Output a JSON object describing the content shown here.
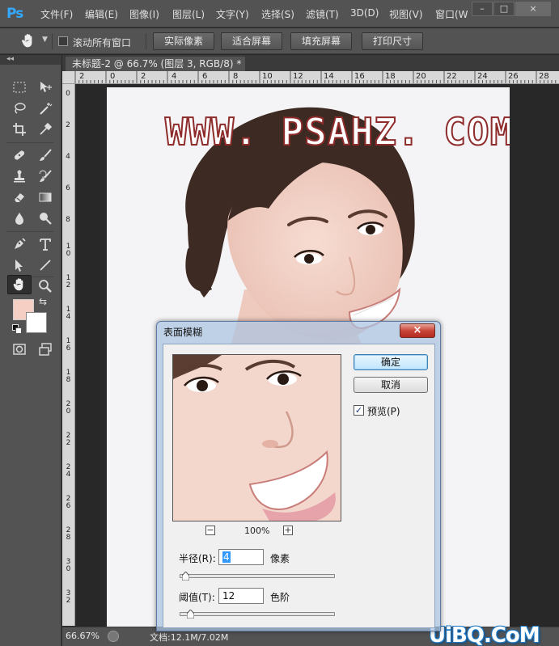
{
  "app": {
    "logo": "Ps",
    "menu": [
      "文件(F)",
      "编辑(E)",
      "图像(I)",
      "图层(L)",
      "文字(Y)",
      "选择(S)",
      "滤镜(T)",
      "3D(D)",
      "视图(V)",
      "窗口(W"
    ],
    "window_controls": [
      "–",
      "□",
      "×"
    ]
  },
  "options_bar": {
    "scroll_all_label": "滚动所有窗口",
    "scroll_all_checked": false,
    "buttons": [
      "实际像素",
      "适合屏幕",
      "填充屏幕",
      "打印尺寸"
    ]
  },
  "toolbox": {
    "collapse_label": "◂◂",
    "tools": [
      "rectangular-marquee-icon",
      "move-icon",
      "lasso-icon",
      "magic-wand-icon",
      "crop-icon",
      "eyedropper-icon",
      "healing-brush-icon",
      "brush-icon",
      "clone-stamp-icon",
      "history-brush-icon",
      "eraser-icon",
      "gradient-icon",
      "blur-icon",
      "dodge-icon",
      "pen-icon",
      "type-icon",
      "path-selection-icon",
      "line-icon",
      "hand-icon",
      "zoom-icon"
    ],
    "active_tool": "hand-icon",
    "foreground_color": "#f6cfc4",
    "background_color": "#ffffff"
  },
  "document": {
    "tab_title": "未标题-2 @ 66.7% (图层 3, RGB/8) *",
    "ruler_top": [
      "2",
      "0",
      "2",
      "4",
      "6",
      "8",
      "10",
      "12",
      "14",
      "16",
      "18",
      "20",
      "22",
      "24",
      "26",
      "28"
    ],
    "ruler_left": [
      "0",
      "2",
      "4",
      "6",
      "8",
      "1 0",
      "1 2",
      "1 4",
      "1 6",
      "1 8",
      "2 0",
      "2 2",
      "2 4",
      "2 6",
      "2 8",
      "3 0",
      "3 2"
    ],
    "watermark": "WWW. PSAHZ. COM"
  },
  "status": {
    "zoom": "66.67%",
    "doc_info": "文档:12.1M/7.02M",
    "site_logo": "UiBQ.CoM"
  },
  "dialog": {
    "title": "表面模糊",
    "close": "×",
    "ok": "确定",
    "cancel": "取消",
    "preview_label": "预览(P)",
    "preview_checked": true,
    "zoom_minus": "−",
    "zoom_plus": "+",
    "zoom_percent": "100%",
    "radius": {
      "label": "半径(R):",
      "value": "4",
      "unit": "像素",
      "level": 0.02
    },
    "threshold": {
      "label": "阈值(T):",
      "value": "12",
      "unit": "色阶",
      "level": 0.05
    }
  }
}
